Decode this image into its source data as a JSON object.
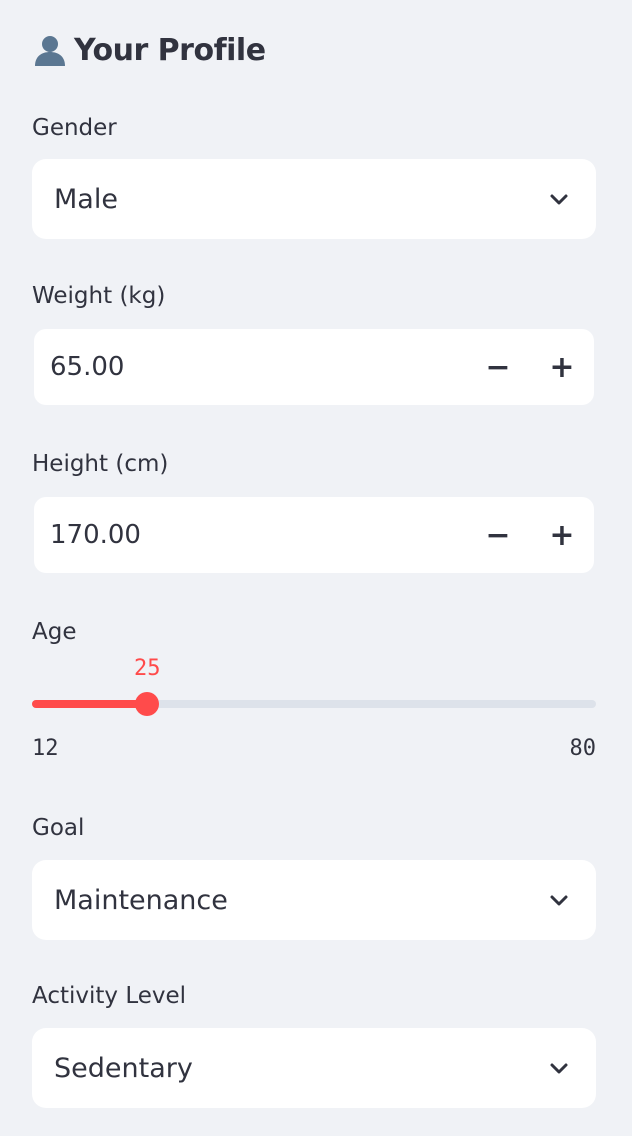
{
  "header": {
    "title": "Your Profile",
    "icon": "bust-in-silhouette-icon"
  },
  "gender": {
    "label": "Gender",
    "value": "Male"
  },
  "weight": {
    "label": "Weight (kg)",
    "value": "65.00",
    "minus": "−",
    "plus": "+"
  },
  "height": {
    "label": "Height (cm)",
    "value": "170.00",
    "minus": "−",
    "plus": "+"
  },
  "age": {
    "label": "Age",
    "value": 25,
    "value_text": "25",
    "min": 12,
    "max": 80,
    "min_text": "12",
    "max_text": "80"
  },
  "goal": {
    "label": "Goal",
    "value": "Maintenance"
  },
  "activity": {
    "label": "Activity Level",
    "value": "Sedentary"
  },
  "colors": {
    "accent": "#ff4b4b",
    "background": "#f0f2f6",
    "text": "#31333f",
    "track": "#dde2ea"
  }
}
